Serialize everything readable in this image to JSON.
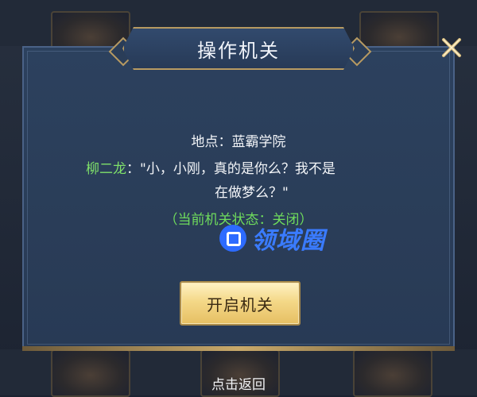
{
  "dialog": {
    "title": "操作机关",
    "location_line": "地点：蓝霸学院",
    "speaker_name": "柳二龙",
    "speech_line1": "：\"小，小刚，真的是你么？我不是",
    "speech_line2": "在做梦么？\"",
    "mechanism_state": "（当前机关状态：关闭）",
    "primary_button": "开启机关",
    "close_icon": "close-x-icon"
  },
  "footer": {
    "back_hint": "点击返回"
  },
  "watermark": {
    "text": "领域圈",
    "logo_icon": "watermark-logo-icon"
  },
  "colors": {
    "panel": "#2c415e",
    "gold": "#b79a62",
    "speaker": "#7fe06a",
    "state": "#6fdc5c",
    "button": "#f4d888",
    "watermark": "#2d6bff"
  }
}
